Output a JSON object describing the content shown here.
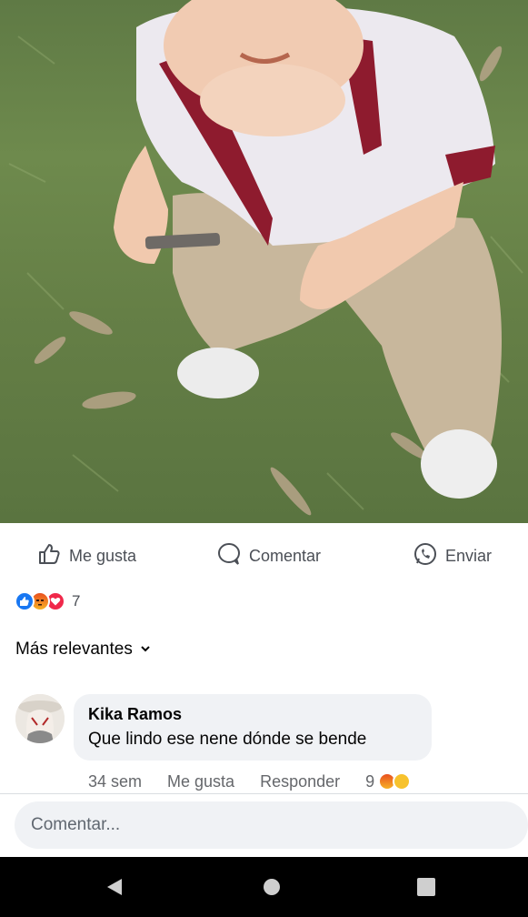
{
  "post": {
    "photo_icon": "photo-of-toddler-on-grass"
  },
  "actions": {
    "like_label": "Me gusta",
    "comment_label": "Comentar",
    "send_label": "Enviar",
    "like_icon": "thumbs-up-icon",
    "comment_icon": "comment-bubble-icon",
    "send_icon": "whatsapp-icon"
  },
  "reactions": {
    "types": [
      "like",
      "angry",
      "love"
    ],
    "count": "7"
  },
  "comments_section": {
    "sort_label": "Más relevantes"
  },
  "comment": {
    "author": "Kika Ramos",
    "text": "Que lindo ese nene dónde se bende",
    "time": "34 sem",
    "like_label": "Me gusta",
    "reply_label": "Responder",
    "reaction_count": "9",
    "reaction_types": [
      "angry",
      "haha"
    ]
  },
  "composer": {
    "placeholder": "Comentar..."
  },
  "colors": {
    "facebook_blue": "#1877f2",
    "secondary_text": "#65676b",
    "bubble_bg": "#f0f2f5"
  }
}
